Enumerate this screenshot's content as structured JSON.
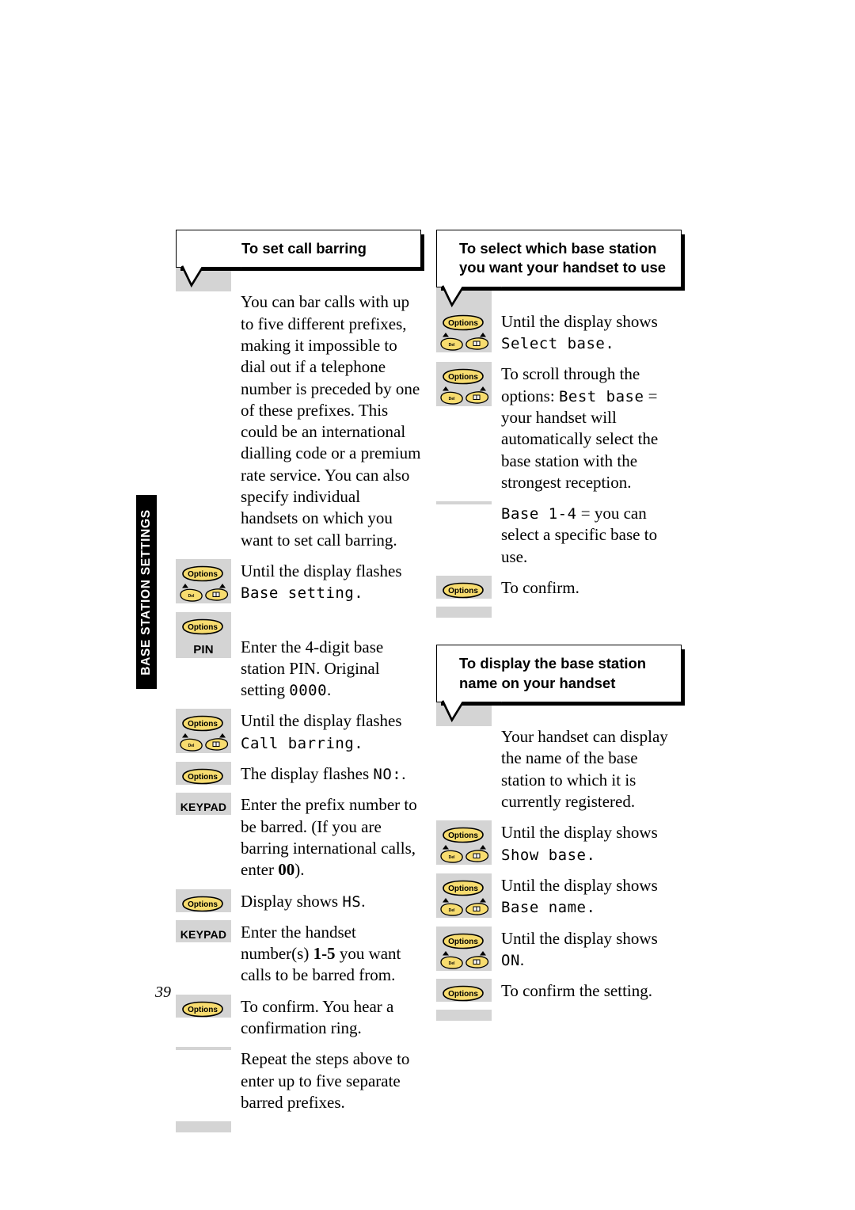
{
  "page": {
    "number": "39",
    "side_tab_label": "BASE STATION SETTINGS",
    "colors": {
      "gutter_gray": "#d4d4d4",
      "button_yellow": "#f7dc6f",
      "tab_black": "#000000"
    }
  },
  "icons": {
    "options_button": "options-button-icon",
    "del_key": "del-key-icon",
    "book_key": "phonebook-key-icon",
    "up_arrow": "up-arrow-icon",
    "down_arrow": "down-arrow-icon"
  },
  "icon_labels": {
    "options": "Options",
    "del": "Del"
  },
  "sections": [
    {
      "id": "call-barring",
      "title": "To set call barring",
      "title_align": "center",
      "steps": [
        {
          "key": "none",
          "text_parts": [
            {
              "t": "You can bar calls with up to five different prefixes, making it impossible to dial out if a telephone number is preceded by one of these prefixes. This could be an international dialling code or a premium rate service. You can also specify individual handsets on which you want to set call barring.",
              "style": "normal"
            }
          ]
        },
        {
          "key": "options-arrows",
          "text_parts": [
            {
              "t": "Until the display flashes ",
              "style": "normal"
            },
            {
              "t": "Base setting.",
              "style": "lcd"
            }
          ]
        },
        {
          "key": "options",
          "text_parts": []
        },
        {
          "key": "label",
          "key_label": "PIN",
          "text_parts": [
            {
              "t": "Enter the 4-digit base station PIN. Original setting ",
              "style": "normal"
            },
            {
              "t": "0000",
              "style": "lcd"
            },
            {
              "t": ".",
              "style": "normal"
            }
          ]
        },
        {
          "key": "options-arrows",
          "text_parts": [
            {
              "t": "Until the display flashes ",
              "style": "normal"
            },
            {
              "t": "Call barring.",
              "style": "lcd"
            }
          ]
        },
        {
          "key": "options",
          "text_parts": [
            {
              "t": "The display flashes ",
              "style": "normal"
            },
            {
              "t": "NO:",
              "style": "lcd"
            },
            {
              "t": ".",
              "style": "normal"
            }
          ]
        },
        {
          "key": "label",
          "key_label": "KEYPAD",
          "text_parts": [
            {
              "t": "Enter the prefix number to be barred. (If you are barring international calls, enter ",
              "style": "normal"
            },
            {
              "t": "00",
              "style": "bold"
            },
            {
              "t": ").",
              "style": "normal"
            }
          ]
        },
        {
          "key": "options",
          "text_parts": [
            {
              "t": "Display shows ",
              "style": "normal"
            },
            {
              "t": "HS",
              "style": "lcd"
            },
            {
              "t": ".",
              "style": "normal"
            }
          ]
        },
        {
          "key": "label",
          "key_label": "KEYPAD",
          "text_parts": [
            {
              "t": "Enter the handset number(s) ",
              "style": "normal"
            },
            {
              "t": "1-5",
              "style": "bold"
            },
            {
              "t": " you want calls to be barred from.",
              "style": "normal"
            }
          ]
        },
        {
          "key": "options",
          "text_parts": [
            {
              "t": "To confirm. You hear a confirmation ring.",
              "style": "normal"
            }
          ]
        },
        {
          "key": "none",
          "text_parts": [
            {
              "t": "Repeat the steps above to enter up to five separate barred prefixes.",
              "style": "normal"
            }
          ]
        }
      ]
    },
    {
      "id": "select-base-station",
      "title": "To select which base station you want your handset to use",
      "title_align": "left",
      "steps": [
        {
          "key": "options-arrows",
          "text_parts": [
            {
              "t": "Until the display shows ",
              "style": "normal"
            },
            {
              "t": "Select base.",
              "style": "lcd"
            }
          ]
        },
        {
          "key": "options-arrows",
          "text_parts": [
            {
              "t": "To scroll through the options: ",
              "style": "normal"
            },
            {
              "t": "Best base",
              "style": "lcd"
            },
            {
              "t": " = your handset will automatically select the base station with the strongest reception.",
              "style": "normal"
            }
          ]
        },
        {
          "key": "none",
          "text_parts": [
            {
              "t": "Base 1-4",
              "style": "lcd"
            },
            {
              "t": " = you can select a specific base to use.",
              "style": "normal"
            }
          ]
        },
        {
          "key": "options",
          "text_parts": [
            {
              "t": "To confirm.",
              "style": "normal"
            }
          ]
        }
      ]
    },
    {
      "id": "display-base-name",
      "title": "To display the base station name on your handset",
      "title_align": "left",
      "steps": [
        {
          "key": "none",
          "text_parts": [
            {
              "t": "Your handset can display the name of the base station to which it is currently registered.",
              "style": "normal"
            }
          ]
        },
        {
          "key": "options-arrows",
          "text_parts": [
            {
              "t": "Until the display shows ",
              "style": "normal"
            },
            {
              "t": "Show base.",
              "style": "lcd"
            }
          ]
        },
        {
          "key": "options-arrows",
          "text_parts": [
            {
              "t": "Until the display shows ",
              "style": "normal"
            },
            {
              "t": "Base name.",
              "style": "lcd"
            }
          ]
        },
        {
          "key": "options-arrows",
          "text_parts": [
            {
              "t": "Until the display shows ",
              "style": "normal"
            },
            {
              "t": "ON",
              "style": "lcd"
            },
            {
              "t": ".",
              "style": "normal"
            }
          ]
        },
        {
          "key": "options",
          "text_parts": [
            {
              "t": "To confirm the setting.",
              "style": "normal"
            }
          ]
        }
      ]
    }
  ]
}
